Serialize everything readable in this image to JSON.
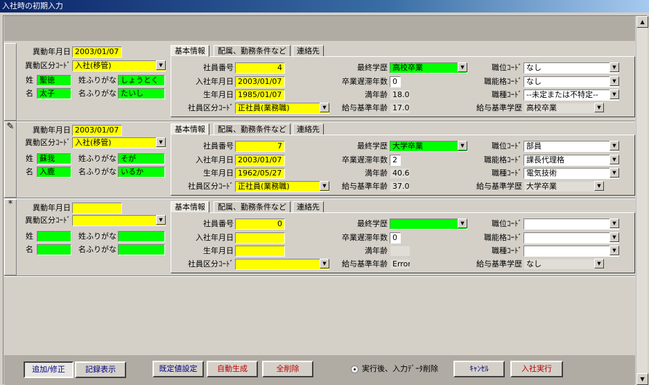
{
  "window": {
    "title": "入社時の初期入力"
  },
  "labels": {
    "move_date": "異動年月日",
    "move_code": "異動区分ｺｰﾄﾞ",
    "sei": "姓",
    "sei_kana": "姓ふりがな",
    "mei": "名",
    "mei_kana": "名ふりがな",
    "emp_no": "社員番号",
    "hire_date": "入社年月日",
    "birth_date": "生年月日",
    "emp_class": "社員区分ｺｰﾄﾞ",
    "education": "最終学歴",
    "grad_delay": "卒業遅滞年数",
    "age": "満年齢",
    "pay_age": "給与基準年齢",
    "position": "職位ｺｰﾄﾞ",
    "grade": "職能格ｺｰﾄﾞ",
    "job_type": "職種ｺｰﾄﾞ",
    "pay_edu": "給与基準学歴"
  },
  "tabs": [
    "基本情報",
    "配属、勤務条件など",
    "連絡先"
  ],
  "records": [
    {
      "selector": "",
      "move_date": "2003/01/07",
      "move_code": "入社(移管)",
      "sei": "聖徳",
      "sei_kana": "しょうとく",
      "mei": "太子",
      "mei_kana": "たいし",
      "emp_no": "4",
      "hire_date": "2003/01/07",
      "birth_date": "1985/01/07",
      "emp_class": "正社員(業務職)",
      "education": "高校卒業",
      "grad_delay": "0",
      "age": "18.0",
      "pay_age": "17.0",
      "position": "なし",
      "grade": "なし",
      "job_type": "--未定または不特定--",
      "pay_edu": "高校卒業"
    },
    {
      "selector": "✎",
      "move_date": "2003/01/07",
      "move_code": "入社(移管)",
      "sei": "蘇我",
      "sei_kana": "そが",
      "mei": "入鹿",
      "mei_kana": "いるか",
      "emp_no": "7",
      "hire_date": "2003/01/07",
      "birth_date": "1962/05/27",
      "emp_class": "正社員(業務職)",
      "education": "大学卒業",
      "grad_delay": "2",
      "age": "40.6",
      "pay_age": "37.0",
      "position": "部員",
      "grade": "課長代理格",
      "job_type": "電気技術",
      "pay_edu": "大学卒業"
    },
    {
      "selector": "*",
      "move_date": "",
      "move_code": "",
      "sei": "",
      "sei_kana": "",
      "mei": "",
      "mei_kana": "",
      "emp_no": "0",
      "hire_date": "",
      "birth_date": "",
      "emp_class": "",
      "education": "",
      "grad_delay": "0",
      "age": "",
      "pay_age": "Error",
      "position": "",
      "grade": "",
      "job_type": "",
      "pay_edu": "なし"
    }
  ],
  "footer": {
    "add_edit": "追加/修正",
    "view_records": "記録表示",
    "defaults": "既定値設定",
    "auto_gen": "自動生成",
    "delete_all": "全削除",
    "radio_label": "実行後、入力ﾃﾞｰﾀ削除",
    "cancel": "ｷｬﾝｾﾙ",
    "execute": "入社実行"
  },
  "colors": {
    "required_field": "#ffff00",
    "name_field": "#00ff00",
    "surface": "#d4d0c8",
    "band": "#b0aca4",
    "title_start": "#0a246a",
    "btn_red_text": "#c00000",
    "btn_blue_text": "#000080"
  }
}
